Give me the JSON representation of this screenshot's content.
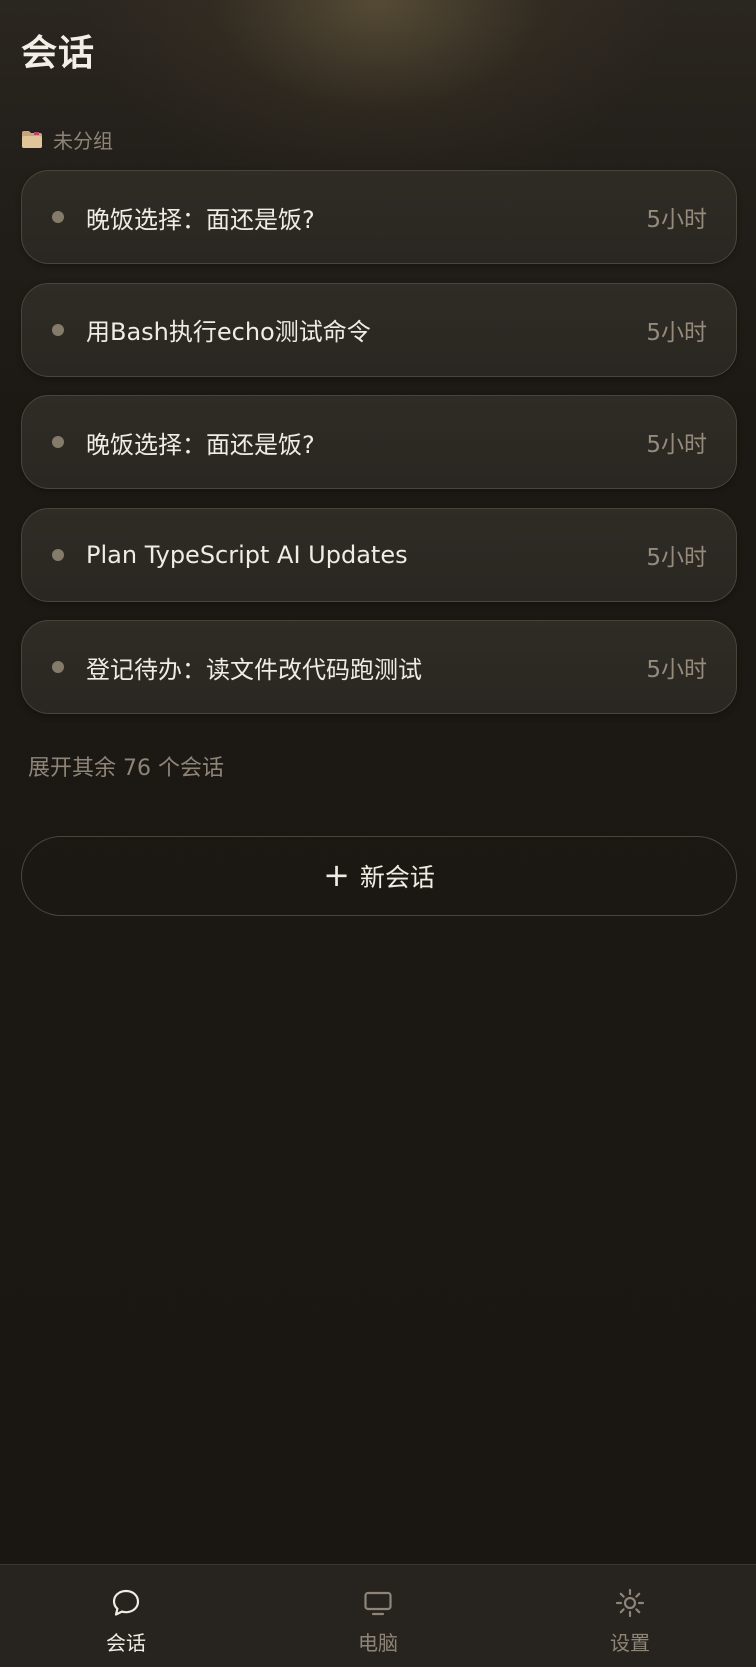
{
  "header": {
    "title": "会话"
  },
  "group": {
    "icon": "folder-icon",
    "label": "未分组"
  },
  "conversations": [
    {
      "title": "晚饭选择：面还是饭?",
      "time": "5小时"
    },
    {
      "title": "用Bash执行echo测试命令",
      "time": "5小时"
    },
    {
      "title": "晚饭选择：面还是饭?",
      "time": "5小时"
    },
    {
      "title": "Plan TypeScript AI Updates",
      "time": "5小时"
    },
    {
      "title": "登记待办：读文件改代码跑测试",
      "time": "5小时"
    }
  ],
  "expand": {
    "label": "展开其余 76 个会话"
  },
  "new_chat": {
    "icon": "plus-icon",
    "label": "新会话"
  },
  "nav": {
    "tabs": [
      {
        "label": "会话",
        "icon": "chat-bubble-icon",
        "active": true
      },
      {
        "label": "电脑",
        "icon": "monitor-icon",
        "active": false
      },
      {
        "label": "设置",
        "icon": "sun-gear-icon",
        "active": false
      }
    ]
  },
  "colors": {
    "background": "#1a1612",
    "card": "#2c2823",
    "card_border": "#4a443b",
    "accent_text": "#f1ece3",
    "muted_text": "#8e8578"
  }
}
